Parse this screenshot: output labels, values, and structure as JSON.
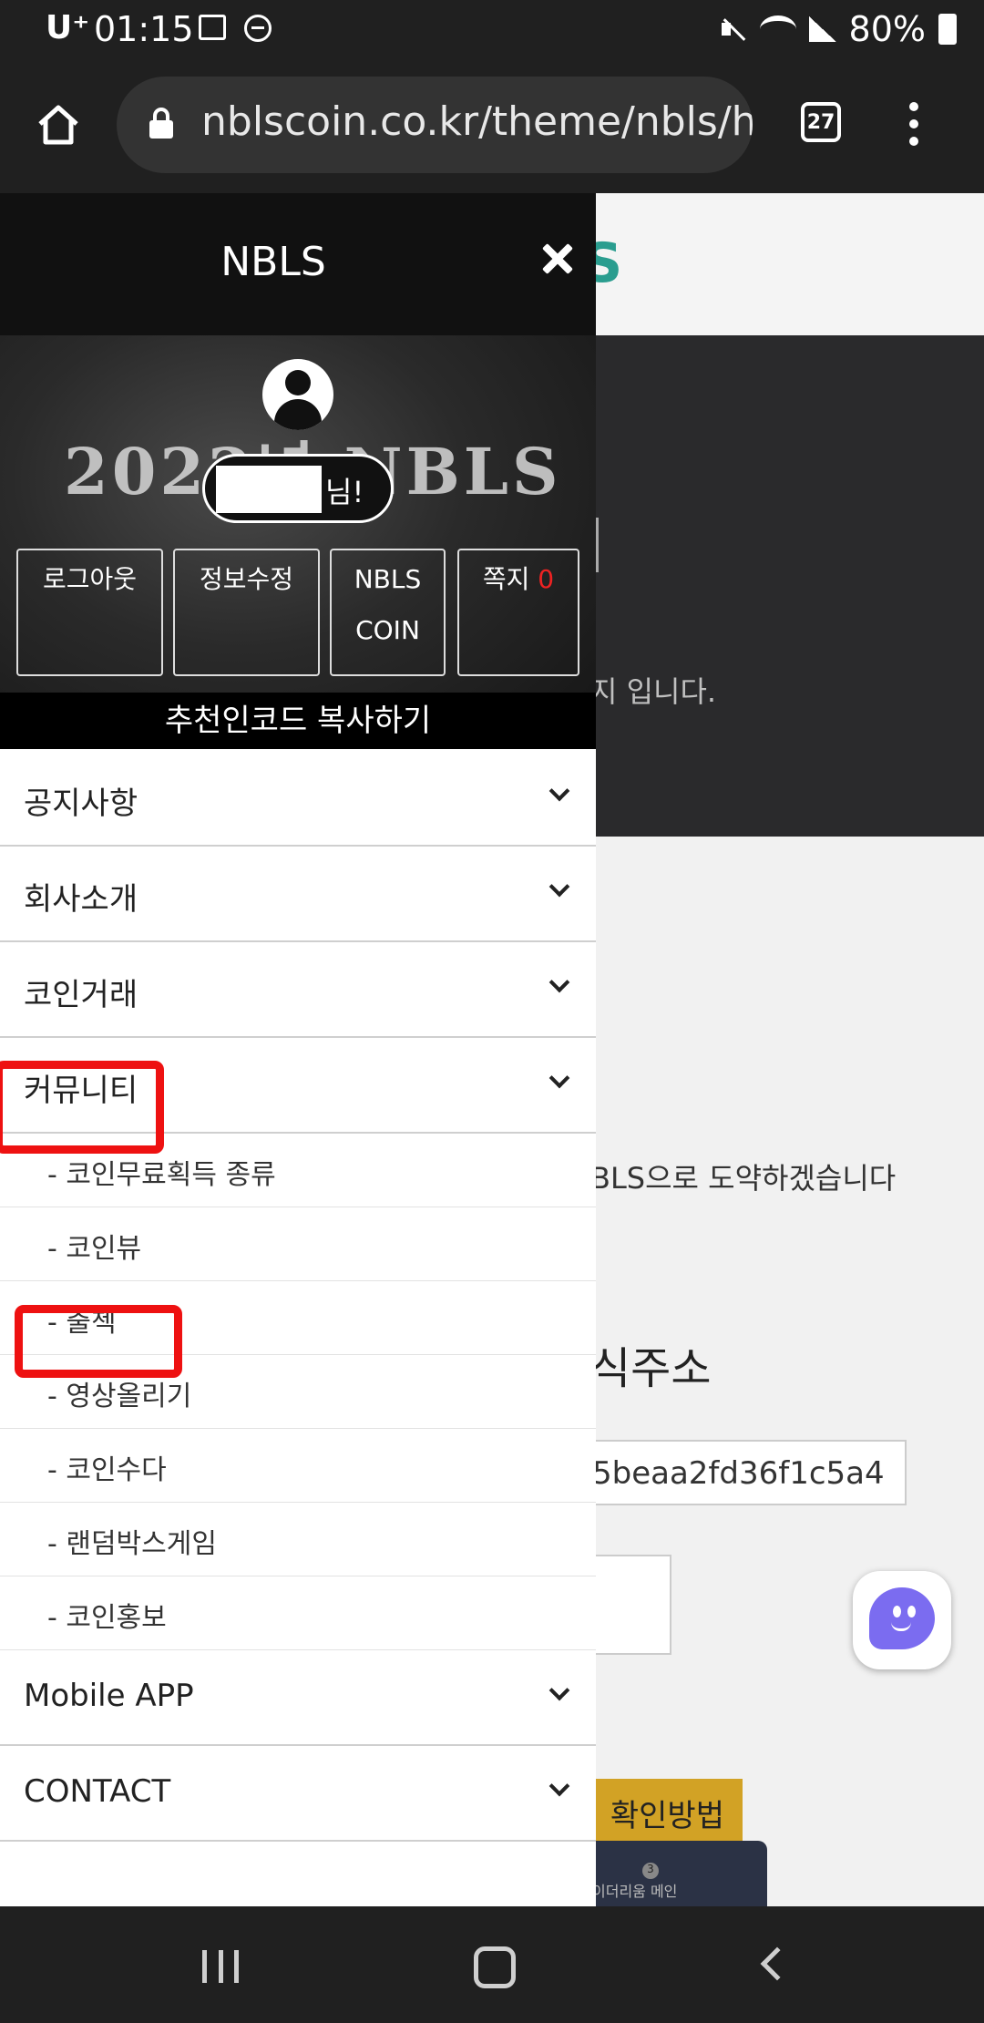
{
  "status_bar": {
    "carrier": "U⁺",
    "time": "01:15",
    "battery": "80%"
  },
  "browser": {
    "url": "nblscoin.co.kr/theme/nbls/h",
    "tab_count": "27"
  },
  "drawer": {
    "title": "NBLS",
    "banner_text": "2022년 NBLS",
    "user_suffix": "님!",
    "buttons": {
      "logout": "로그아웃",
      "edit_profile": "정보수정",
      "nbls_coin_line1": "NBLS",
      "nbls_coin_line2": "COIN",
      "messages": "쪽지",
      "messages_count": "0"
    },
    "referral": "추천인코드 복사하기",
    "menu": [
      {
        "label": "공지사항"
      },
      {
        "label": "회사소개"
      },
      {
        "label": "코인거래"
      },
      {
        "label": "커뮤니티"
      },
      {
        "label": "Mobile APP"
      },
      {
        "label": "CONTACT"
      }
    ],
    "community_sub": [
      {
        "label": "- 코인무료획득 종류"
      },
      {
        "label": "- 코인뷰"
      },
      {
        "label": "- 출첵"
      },
      {
        "label": "- 영상올리기"
      },
      {
        "label": "- 코인수다"
      },
      {
        "label": "- 랜덤박스게임"
      },
      {
        "label": "- 코인홍보"
      }
    ]
  },
  "background_page": {
    "hero_text": "지 입니다.",
    "body_text": "BLS으로 도약하겠습니다",
    "heading": "식주소",
    "address": "5beaa2fd36f1c5a4",
    "confirm_button": "확인방법",
    "notice_badge": "3",
    "notice_text": "이더리움 메인",
    "logo_fragment": "S"
  },
  "colors": {
    "highlight": "#ee1111",
    "message_count": "#ee2222",
    "gold_button": "#d2a225",
    "chat_bubble": "#7b6cf0"
  },
  "icons": [
    "home-icon",
    "lock-icon",
    "tabs-icon",
    "more-icon",
    "close-icon",
    "avatar-icon",
    "chevron-down-icon",
    "chat-icon",
    "nav-recent-icon",
    "nav-home-icon",
    "nav-back-icon"
  ]
}
